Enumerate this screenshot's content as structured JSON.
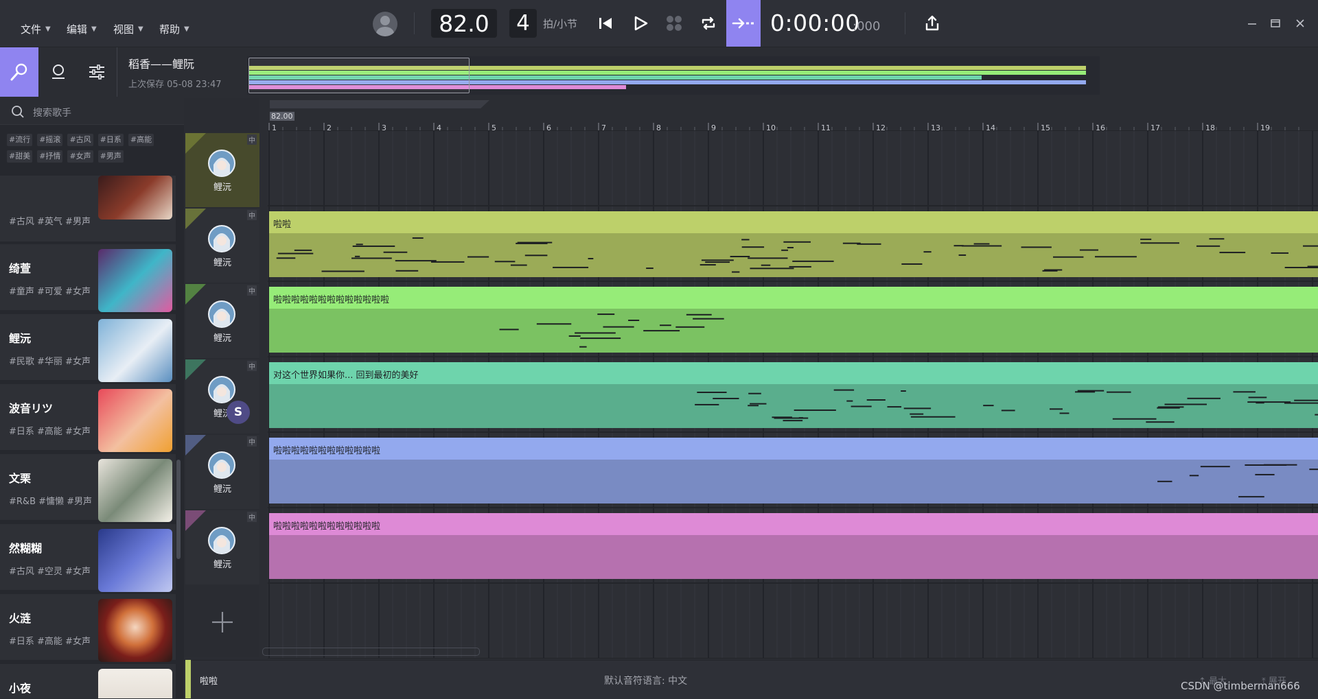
{
  "menu": [
    {
      "label": "文件"
    },
    {
      "label": "编辑"
    },
    {
      "label": "视图"
    },
    {
      "label": "帮助"
    }
  ],
  "transport": {
    "tempo": "82.0",
    "beats": "4",
    "beats_label": "拍/小节",
    "time": "0:00:00",
    "time_ms": ":000"
  },
  "project": {
    "name": "稻香——鲤阮",
    "saved": "上次保存 05-08 23:47"
  },
  "search": {
    "placeholder": "搜索歌手"
  },
  "tags": [
    "#流行",
    "#摇滚",
    "#古风",
    "#日系",
    "#高能",
    "#甜美",
    "#抒情",
    "#女声",
    "#男声"
  ],
  "singers": [
    {
      "name": "",
      "tags": "#古风 #英气 #男声"
    },
    {
      "name": "绮萱",
      "tags": "#童声 #可爱 #女声"
    },
    {
      "name": "鲤沅",
      "tags": "#民歌 #华丽 #女声"
    },
    {
      "name": "波音リツ",
      "tags": "#日系 #高能 #女声"
    },
    {
      "name": "文栗",
      "tags": "#R&B #慵懒 #男声"
    },
    {
      "name": "然糊糊",
      "tags": "#古风 #空灵 #女声"
    },
    {
      "name": "火涟",
      "tags": "#日系 #高能 #女声"
    },
    {
      "name": "小夜",
      "tags": ""
    }
  ],
  "ruler": {
    "tempo_marker": "82.00",
    "bars": [
      "1",
      "2",
      "3",
      "4",
      "5",
      "6",
      "7",
      "8",
      "9",
      "10",
      "11",
      "12",
      "13",
      "14",
      "15",
      "16",
      "17",
      "18",
      "19"
    ]
  },
  "tracks": [
    {
      "singer": "鲤沅",
      "channel": "中",
      "lyric": "",
      "color": "#7f8a3d"
    },
    {
      "singer": "鲤沅",
      "channel": "中",
      "lyric": "啦啦",
      "color": "#bdd06a"
    },
    {
      "singer": "鲤沅",
      "channel": "中",
      "lyric": "啦啦啦啦啦啦啦啦啦啦啦啦啦",
      "color": "#96ec78"
    },
    {
      "singer": "鲤沅",
      "channel": "中",
      "lyric": "对这个世界如果你... 回到最初的美好",
      "color": "#6ed4ac",
      "badge": "S"
    },
    {
      "singer": "鲤沅",
      "channel": "中",
      "lyric": "啦啦啦啦啦啦啦啦啦啦啦啦",
      "color": "#93a9ee"
    },
    {
      "singer": "鲤沅",
      "channel": "中",
      "lyric": "啦啦啦啦啦啦啦啦啦啦啦啦",
      "color": "#de8ad6"
    }
  ],
  "bottom": {
    "lyric": "啦啦",
    "language": "默认音符语言: 中文",
    "maximize": "最大",
    "expand": "展开"
  },
  "watermark": "CSDN @timberman666"
}
